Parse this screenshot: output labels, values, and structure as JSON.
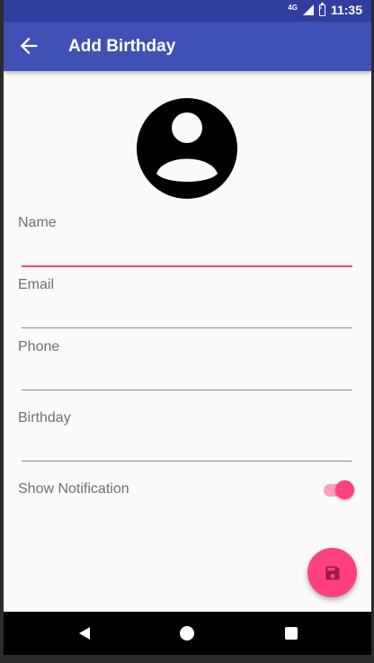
{
  "status_bar": {
    "network": "4G",
    "time": "11:35"
  },
  "app_bar": {
    "title": "Add Birthday"
  },
  "form": {
    "name_label": "Name",
    "name_value": "",
    "email_label": "Email",
    "email_value": "",
    "phone_label": "Phone",
    "phone_value": "",
    "birthday_label": "Birthday",
    "birthday_value": "",
    "notification_label": "Show Notification",
    "notification_on": true
  },
  "fab": {
    "icon": "save-icon"
  },
  "colors": {
    "primary": "#3f51b5",
    "primary_dark": "#303f9f",
    "accent": "#ff4081"
  }
}
